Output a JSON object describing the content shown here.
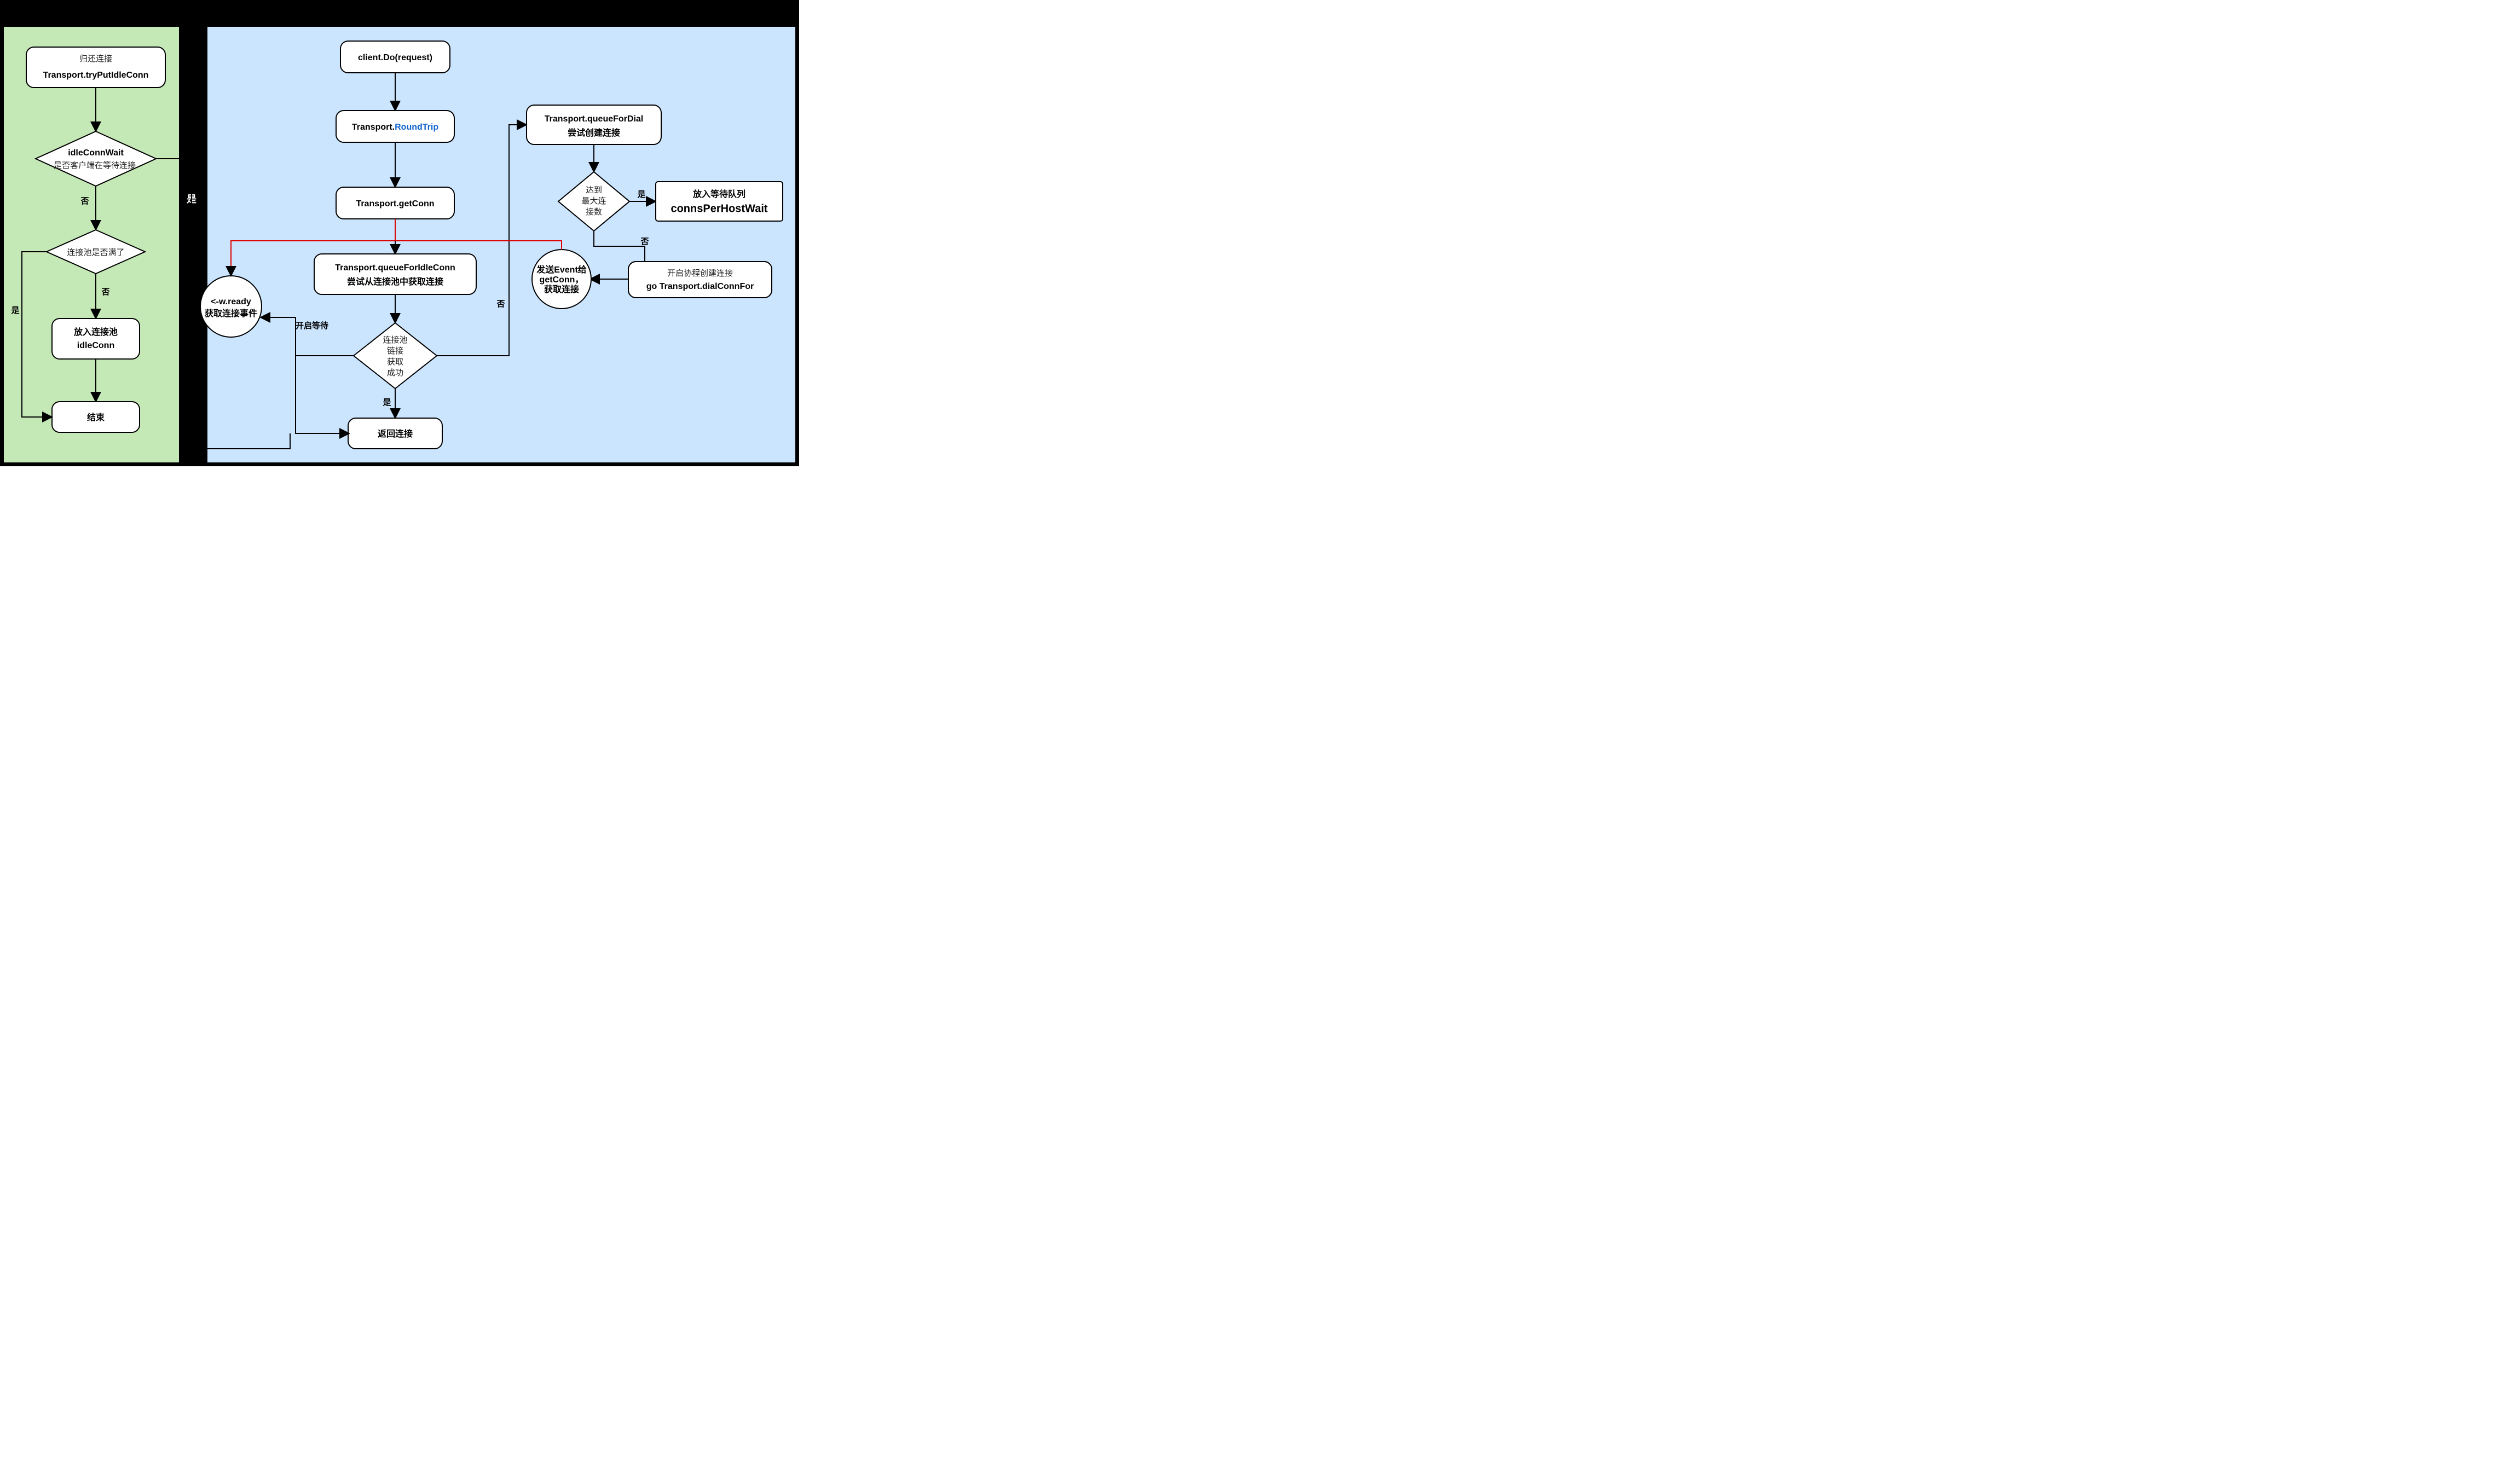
{
  "left": {
    "return_conn": {
      "l1": "归还连接",
      "l2": "Transport.tryPutIdleConn"
    },
    "idle_wait": {
      "l1": "idleConnWait",
      "l2": "是否客户端在等待连接"
    },
    "pool_full": "连接池是否满了",
    "put_pool": {
      "l1": "放入连接池",
      "l2": "idleConn"
    },
    "end": "结束",
    "yes": "是",
    "no": "否",
    "edge_yes_out": "是"
  },
  "right": {
    "client_do": "client.Do(request)",
    "roundtrip_a": "Transport.",
    "roundtrip_b": "RoundTrip",
    "get_conn": "Transport.getConn",
    "queue_idle": {
      "l1": "Transport.queueForIdleConn",
      "l2": "尝试从连接池中获取连接"
    },
    "pool_ok": {
      "l1": "连接池",
      "l2": "链接",
      "l3": "获取",
      "l4": "成功"
    },
    "wready": {
      "l1": "<-w.ready",
      "l2": "获取连接事件"
    },
    "return_conn": "返回连接",
    "start_wait": "开启等待",
    "yes": "是",
    "no": "否",
    "queue_dial": {
      "l1": "Transport.queueForDial",
      "l2": "尝试创建连接"
    },
    "max_conn": {
      "l1": "达到",
      "l2": "最大连",
      "l3": "接数"
    },
    "wait_queue": {
      "l1": "放入等待队列",
      "l2": "connsPerHostWait"
    },
    "dial_for": {
      "l1": "开启协程创建连接",
      "l2": "go Transport.dialConnFor"
    },
    "send_event": {
      "l1": "发送Event给",
      "l2": "getConn，",
      "l3": "获取连接"
    }
  }
}
